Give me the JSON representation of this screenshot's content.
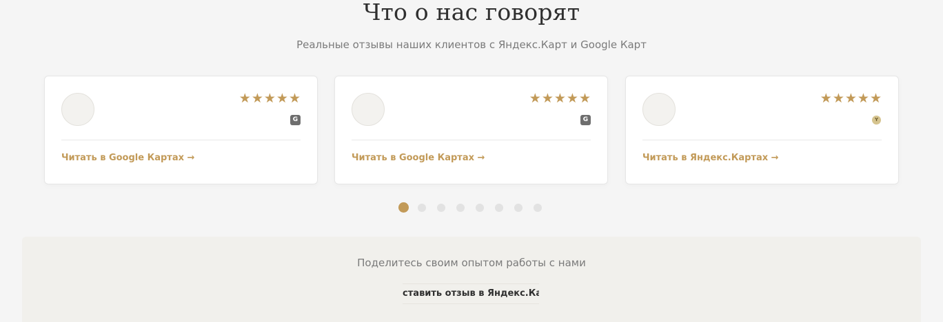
{
  "section": {
    "title": "Что о нас говорят",
    "subtitle": "Реальные отзывы наших клиентов с Яндекс.Карт и Google Карт"
  },
  "reviews": [
    {
      "rating": 5,
      "source_icon": "google-icon",
      "source_letter": "G",
      "link_label": "Читать в Google Картах →"
    },
    {
      "rating": 5,
      "source_icon": "google-icon",
      "source_letter": "G",
      "link_label": "Читать в Google Картах →"
    },
    {
      "rating": 5,
      "source_icon": "yandex-icon",
      "source_letter": "Y",
      "link_label": "Читать в Яндекс.Картах →"
    }
  ],
  "pagination": {
    "total": 8,
    "active": 1
  },
  "share": {
    "text": "Поделитесь своим опытом работы с нами",
    "button_label": "Оставить отзыв в Яндекс.Картах"
  },
  "colors": {
    "accent": "#c29a58",
    "background": "#f5f5f5",
    "share_background": "#f1f0ec"
  }
}
